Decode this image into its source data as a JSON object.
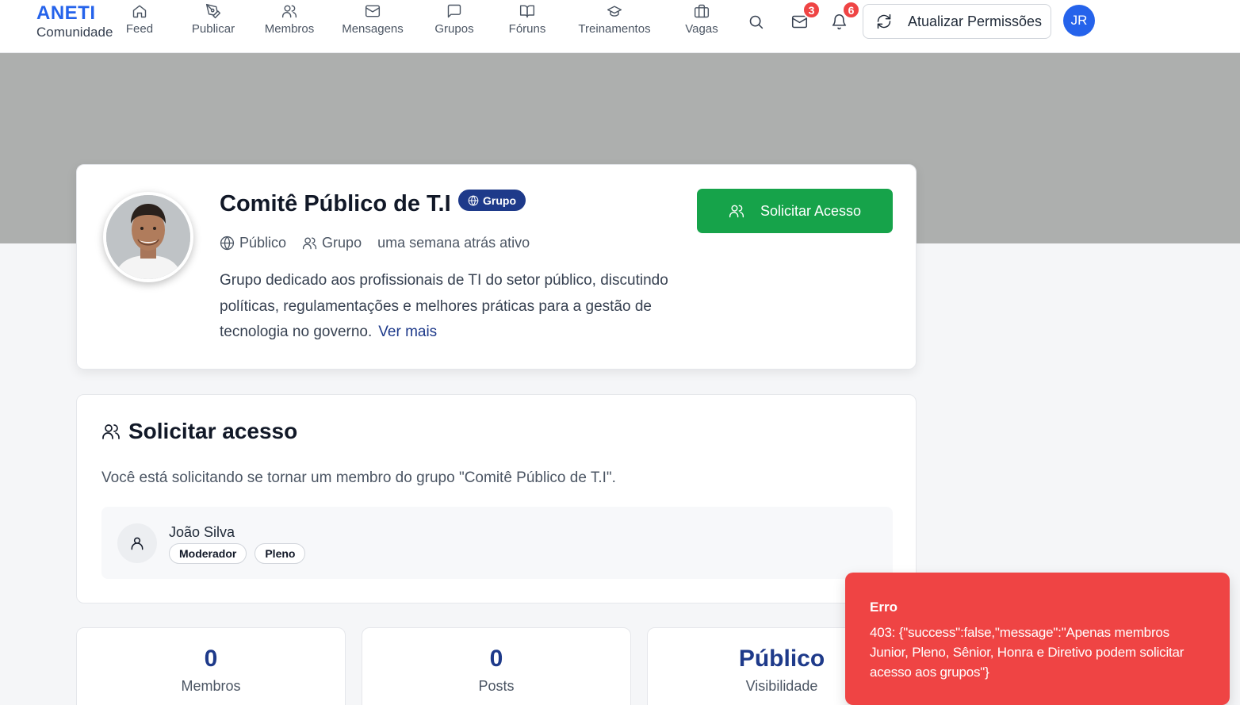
{
  "brand": {
    "name": "ANETI",
    "subtitle": "Comunidade"
  },
  "nav": [
    {
      "label": "Feed",
      "icon": "home-icon"
    },
    {
      "label": "Publicar",
      "icon": "pen-icon"
    },
    {
      "label": "Membros",
      "icon": "users-icon"
    },
    {
      "label": "Mensagens",
      "icon": "mail-icon"
    },
    {
      "label": "Grupos",
      "icon": "chat-icon"
    },
    {
      "label": "Fóruns",
      "icon": "book-icon"
    },
    {
      "label": "Treinamentos",
      "icon": "graduation-cap-icon"
    },
    {
      "label": "Vagas",
      "icon": "briefcase-icon"
    }
  ],
  "header_actions": {
    "messages_count": "3",
    "notifications_count": "6",
    "refresh_label": "Atualizar Permissões",
    "user_initials": "JR"
  },
  "group": {
    "title": "Comitê Público de T.I",
    "type_badge": "Grupo",
    "visibility": "Público",
    "kind": "Grupo",
    "activity": "uma semana atrás ativo",
    "description": "Grupo dedicado aos profissionais de TI do setor público, discutindo políticas, regulamentações e melhores práticas para a gestão de tecnologia no governo.",
    "more_label": "Ver mais",
    "request_button": "Solicitar Acesso"
  },
  "access": {
    "title": "Solicitar acesso",
    "text": "Você está solicitando se tornar um membro do grupo \"Comitê Público de T.I\".",
    "user_name": "João Silva",
    "roles": [
      "Moderador",
      "Pleno"
    ]
  },
  "stats": [
    {
      "value": "0",
      "label": "Membros"
    },
    {
      "value": "0",
      "label": "Posts"
    },
    {
      "value": "Público",
      "label": "Visibilidade"
    }
  ],
  "toast": {
    "title": "Erro",
    "message": "403: {\"success\":false,\"message\":\"Apenas membros Junior, Pleno, Sênior, Honra e Diretivo podem solicitar acesso aos grupos\"}"
  },
  "colors": {
    "brand": "#2563eb",
    "primary_dark": "#1e3a8a",
    "success": "#16a34a",
    "danger": "#ef4444",
    "cover": "#adafae"
  }
}
